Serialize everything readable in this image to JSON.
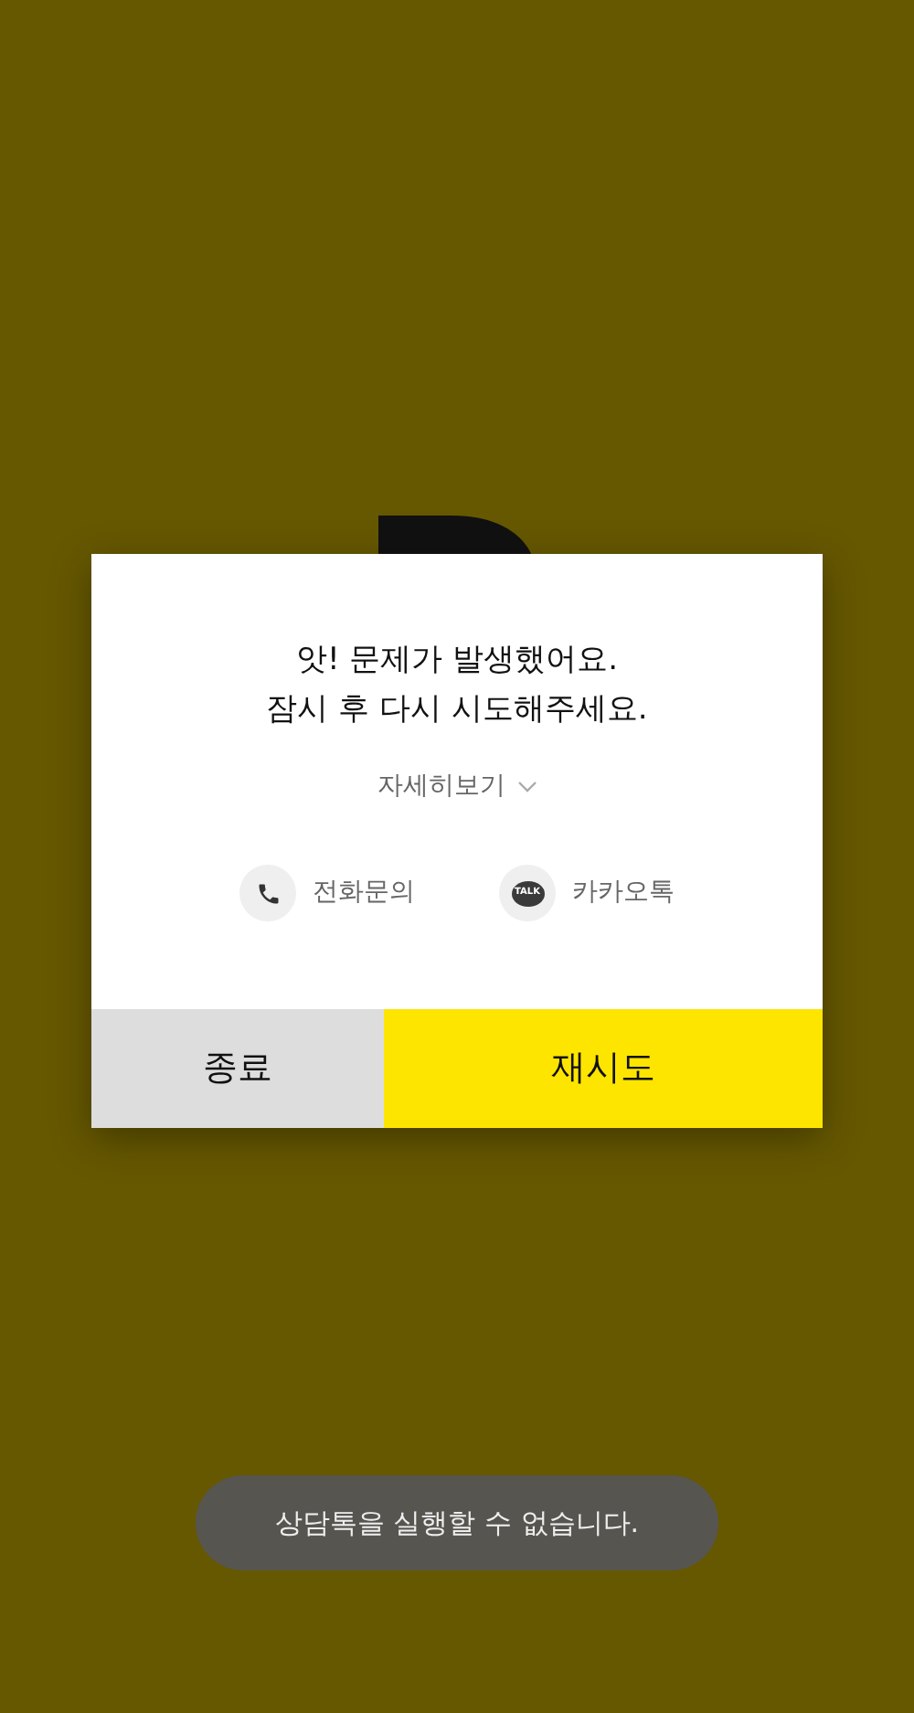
{
  "dialog": {
    "message": [
      "앗! 문제가 발생했어요.",
      "잠시 후 다시 시도해주세요."
    ],
    "details_link": "자세히보기",
    "contacts": [
      {
        "kind": "phone",
        "label": "전화문의"
      },
      {
        "kind": "talk",
        "label": "카카오톡",
        "icon_text": "TALK"
      }
    ],
    "buttons": [
      {
        "kind": "secondary",
        "label": "종료"
      },
      {
        "kind": "primary",
        "label": "재시도"
      }
    ]
  },
  "toast": "상담톡을 실행할 수 없습니다."
}
